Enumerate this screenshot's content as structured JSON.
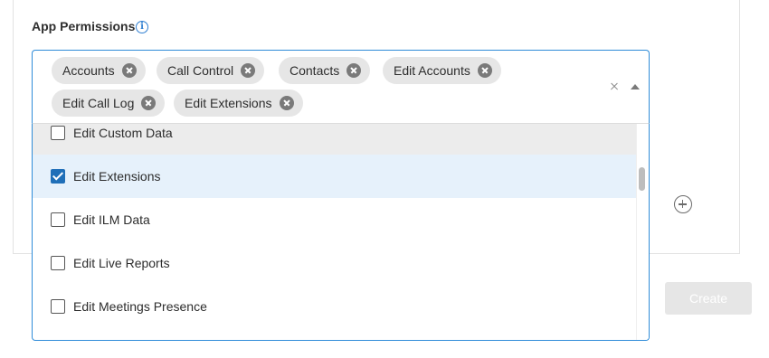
{
  "permissions": {
    "label": "App Permissions",
    "info_icon": "i",
    "selected_chips": [
      "Accounts",
      "Call Control",
      "Contacts",
      "Edit Accounts",
      "Edit Call Log",
      "Edit Extensions"
    ],
    "options": [
      {
        "label": "Edit Custom Data",
        "checked": false,
        "state": "hover"
      },
      {
        "label": "Edit Extensions",
        "checked": true,
        "state": "selected"
      },
      {
        "label": "Edit ILM Data",
        "checked": false,
        "state": "normal"
      },
      {
        "label": "Edit Live Reports",
        "checked": false,
        "state": "normal"
      },
      {
        "label": "Edit Meetings Presence",
        "checked": false,
        "state": "normal"
      }
    ]
  },
  "actions": {
    "create_label": "Create"
  },
  "colors": {
    "accent_blue": "#2f8cd8",
    "checked_blue": "#1f6fb8",
    "selected_row": "#e6f1fb",
    "hover_row": "#ececec",
    "chip_bg": "#e6e6e6",
    "disabled_button": "#e6e6e6"
  },
  "icons": {
    "info": "info-icon",
    "chip_remove": "close-circle-icon",
    "clear": "close-icon",
    "caret": "caret-up-icon",
    "add": "add-circle-icon",
    "checkbox": "checkbox-icon"
  }
}
